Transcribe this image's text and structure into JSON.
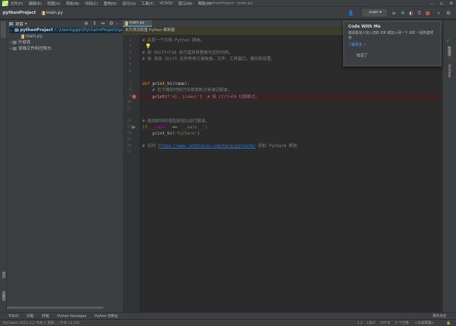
{
  "menu": {
    "items": [
      "文件(F)",
      "编辑(E)",
      "视图(V)",
      "导航(N)",
      "代码(C)",
      "重构(R)",
      "运行(U)",
      "工具(T)",
      "VCS(S)",
      "窗口(W)",
      "帮助(H)"
    ],
    "window_title": "pythonProject - main.py"
  },
  "nav": {
    "project": "pythonProject",
    "file": "main.py",
    "branch": "main"
  },
  "project_panel": {
    "title": "项目",
    "root_name": "pythonProject",
    "root_path": "C:\\Users\\pjqn\\PycharmProjects\\pytho",
    "file": "main.py",
    "external_libs": "外部库",
    "scratches": "草稿文件和控制台"
  },
  "editor": {
    "tab": "main.py",
    "banner": "未为项目配置 Python 解释器",
    "line_numbers": [
      "1",
      "2",
      "3",
      "4",
      "5",
      "6",
      "7",
      "8",
      "9",
      "10",
      "11",
      "12",
      "13",
      "14",
      "15",
      "16",
      "17"
    ],
    "lines": {
      "l1": "# 这是一个示例 Python 脚本。",
      "l3": "# 按 Shift+F10 执行或将其替换为您的代码。",
      "l4": "# 按 双击 Shift 在所有地方搜索类、文件、工具窗口、操作和设置。",
      "l7_kw": "def ",
      "l7_fn": "print_hi",
      "l7_rest": "(name):",
      "l8": "    # 在下面的代码行中使用断点来调试脚本。",
      "l9_a": "    print(",
      "l9_str": "f'Hi, {name}'",
      "l9_b": ")  ",
      "l9_cmt": "# 按 Ctrl+F8 切换断点。",
      "l12": "# 按间距中的绿色按钮以运行脚本。",
      "l13_kw": "if ",
      "l13_d": "__name__",
      "l13_op": " == ",
      "l13_str": "'__main__'",
      "l13_end": ":",
      "l14_a": "    print_hi(",
      "l14_str": "'PyCharm'",
      "l14_b": ")",
      "l16_a": "# 访问 ",
      "l16_link": "https://www.jetbrains.com/help/pycharm/",
      "l16_b": " 获取 PyCharm 帮助"
    }
  },
  "popup": {
    "title": "Code With Me",
    "body": "邀请其他人加入您的 IDE 或加入另一个 IDE 一起构建项目",
    "link": "了解更多 ↗",
    "close": "知道了"
  },
  "left_tools": {
    "structure": "结构",
    "favorites": "收藏夹"
  },
  "right_tools": {
    "database": "数据库",
    "scview": "SciView"
  },
  "bottom_tabs": [
    "TODO",
    "问题",
    "终端",
    "Python Packages",
    "Python 控制台"
  ],
  "event_log": "事件日志",
  "status": {
    "left": "PyCharm 2021.3.2 可用 // 更新... (今天 11:20)",
    "pos": "1:1",
    "eol": "CRLF",
    "enc": "UTF-8",
    "indent": "4 个空格",
    "interp": "<无解释器>"
  },
  "colors": {
    "accent": "#4a88c7",
    "breakpoint": "#c75450",
    "run": "#499c54"
  }
}
